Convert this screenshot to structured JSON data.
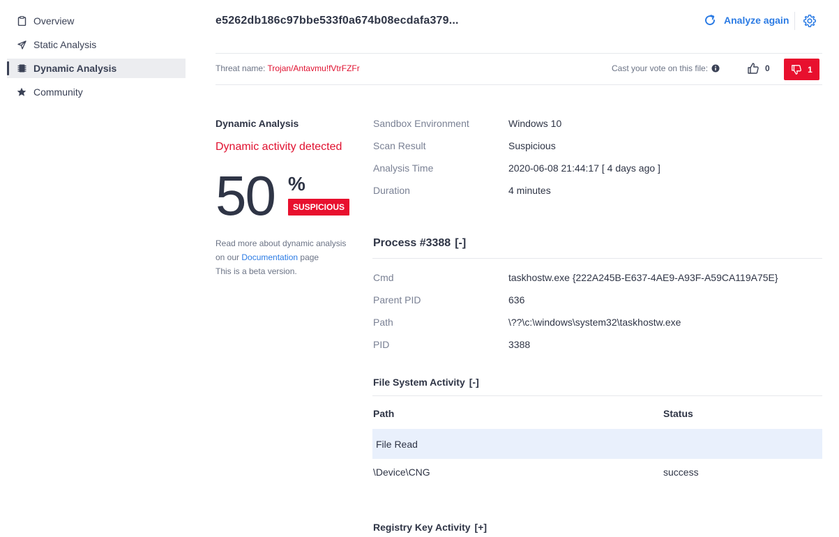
{
  "sidebar": {
    "items": [
      {
        "label": "Overview",
        "icon": "clipboard-icon"
      },
      {
        "label": "Static Analysis",
        "icon": "paper-plane-icon"
      },
      {
        "label": "Dynamic Analysis",
        "icon": "chip-icon",
        "active": true
      },
      {
        "label": "Community",
        "icon": "star-icon"
      }
    ]
  },
  "header": {
    "file_hash": "e5262db186c97bbe533f0a674b08ecdafa379...",
    "analyze_again": "Analyze again"
  },
  "threat": {
    "label": "Threat name:",
    "name": "Trojan/Antavmu!fVtrFZFr"
  },
  "vote": {
    "label": "Cast your vote on this file:",
    "up_count": "0",
    "down_count": "1"
  },
  "summary": {
    "title": "Dynamic Analysis",
    "status": "Dynamic activity detected",
    "score": "50",
    "percent_sign": "%",
    "badge": "SUSPICIOUS",
    "read_more_1": "Read more about dynamic analysis",
    "read_more_2a": "on our ",
    "doc_link": "Documentation",
    "read_more_2b": " page",
    "beta": "This is a beta version."
  },
  "details": {
    "sandbox_label": "Sandbox Environment",
    "sandbox_value": "Windows 10",
    "scan_label": "Scan Result",
    "scan_value": "Suspicious",
    "time_label": "Analysis Time",
    "time_value": "2020-06-08 21:44:17 [ 4 days ago ]",
    "duration_label": "Duration",
    "duration_value": "4 minutes"
  },
  "process": {
    "title": "Process #3388",
    "toggle": "[-]",
    "cmd_label": "Cmd",
    "cmd_value": "taskhostw.exe {222A245B-E637-4AE9-A93F-A59CA119A75E}",
    "ppid_label": "Parent PID",
    "ppid_value": "636",
    "path_label": "Path",
    "path_value": "\\??\\c:\\windows\\system32\\taskhostw.exe",
    "pid_label": "PID",
    "pid_value": "3388"
  },
  "fs_activity": {
    "title": "File System Activity",
    "toggle": "[-]",
    "col_path": "Path",
    "col_status": "Status",
    "group": "File Read",
    "rows": [
      {
        "path": "\\Device\\CNG",
        "status": "success"
      }
    ]
  },
  "registry": {
    "title": "Registry Key Activity",
    "toggle": "[+]"
  },
  "colors": {
    "accent_blue": "#2b7be4",
    "danger_red": "#e8102e",
    "text_dark": "#2f3546",
    "row_highlight": "#e9f0fc"
  }
}
